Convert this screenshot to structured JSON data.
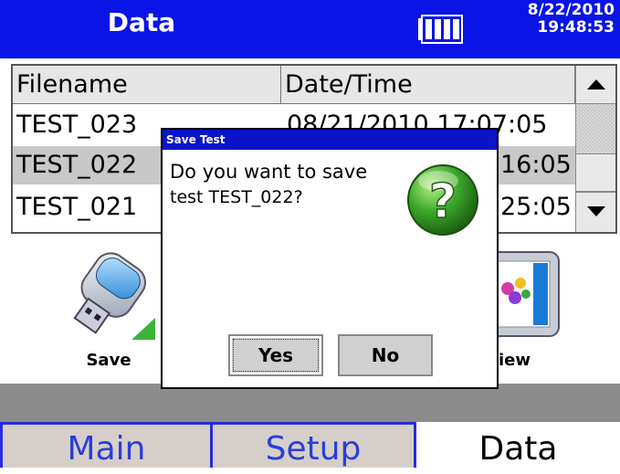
{
  "header": {
    "title": "Data",
    "date": "8/22/2010",
    "time": "19:48:53",
    "battery_icon": "battery-full-icon"
  },
  "table": {
    "columns": [
      "Filename",
      "Date/Time"
    ],
    "rows": [
      {
        "filename": "TEST_023",
        "datetime": "08/21/2010 17:07:05"
      },
      {
        "filename": "TEST_022",
        "datetime": "16:05"
      },
      {
        "filename": "TEST_021",
        "datetime": "25:05"
      }
    ],
    "selected_index": 1
  },
  "actions": {
    "save_label": "Save",
    "view_label": "View",
    "view_visible_label": "iew"
  },
  "dialog": {
    "title": "Save Test",
    "message_line1": "Do you want to save",
    "message_line2": "test TEST_022?",
    "yes_label": "Yes",
    "no_label": "No",
    "icon": "question-icon"
  },
  "tabs": [
    {
      "label": "Main"
    },
    {
      "label": "Setup"
    },
    {
      "label": "Data"
    }
  ],
  "colors": {
    "title_bar": "#0a14e6",
    "tab_border": "#2a2ae0",
    "tab_text": "#2a3ed6",
    "selection": "#c8c8c8"
  }
}
